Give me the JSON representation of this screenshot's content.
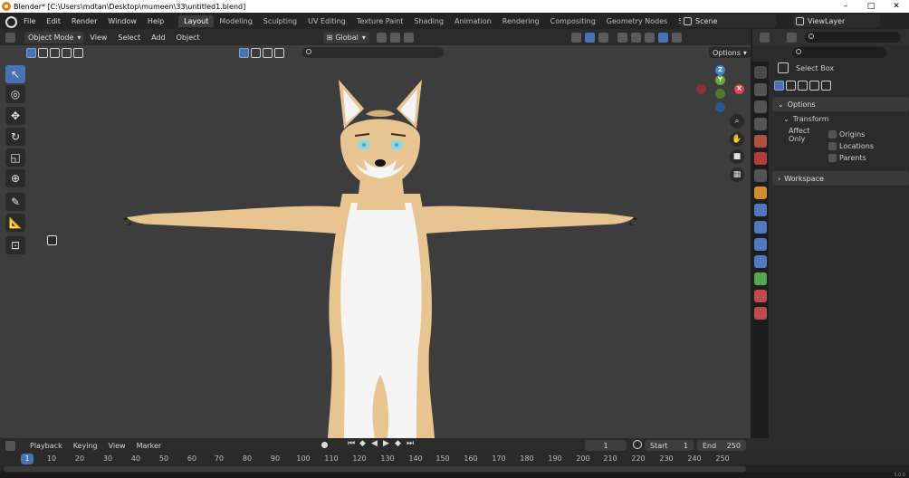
{
  "window": {
    "title": "Blender* [C:\\Users\\mdtan\\Desktop\\mumeen\\33\\untitled1.blend]",
    "controls": [
      "–",
      "□",
      "✕"
    ]
  },
  "topbar": {
    "menus": [
      "File",
      "Edit",
      "Render",
      "Window",
      "Help"
    ],
    "workspaces": [
      "Layout",
      "Modeling",
      "Sculpting",
      "UV Editing",
      "Texture Paint",
      "Shading",
      "Animation",
      "Rendering",
      "Compositing",
      "Geometry Nodes",
      "Scripting"
    ],
    "active_workspace": "Layout",
    "add_workspace": "+",
    "scene": "Scene",
    "view_layer": "ViewLayer"
  },
  "viewport": {
    "mode": "Object Mode",
    "menus": [
      "View",
      "Select",
      "Add",
      "Object"
    ],
    "orientation": "Global",
    "options_label": "Options",
    "gizmo_axes": {
      "x": "X",
      "y": "Y",
      "z": "Z"
    }
  },
  "properties": {
    "active_tool": "Select Box",
    "options_panel": "Options",
    "transform_panel": "Transform",
    "affect_only_label": "Affect Only",
    "affect_only_items": [
      "Origins",
      "Locations",
      "Parents"
    ],
    "workspace_panel": "Workspace"
  },
  "timeline": {
    "menus": [
      "Playback",
      "Keying",
      "View",
      "Marker"
    ],
    "current_frame": "1",
    "start_label": "Start",
    "start_value": "1",
    "end_label": "End",
    "end_value": "250",
    "ruler_ticks": [
      "1",
      "10",
      "20",
      "30",
      "40",
      "50",
      "60",
      "70",
      "80",
      "90",
      "100",
      "110",
      "120",
      "130",
      "140",
      "150",
      "160",
      "170",
      "180",
      "190",
      "200",
      "210",
      "220",
      "230",
      "240",
      "250"
    ],
    "cursor_frame": "1"
  },
  "status": {
    "version": "3.0.0"
  },
  "colors": {
    "accent": "#4772b3",
    "fur_tan": "#e8c590",
    "fur_white": "#f4f4f4",
    "eye": "#8fd6e0",
    "axis_x": "#e0434d",
    "axis_y": "#6aa838",
    "axis_z": "#3f85d6"
  }
}
